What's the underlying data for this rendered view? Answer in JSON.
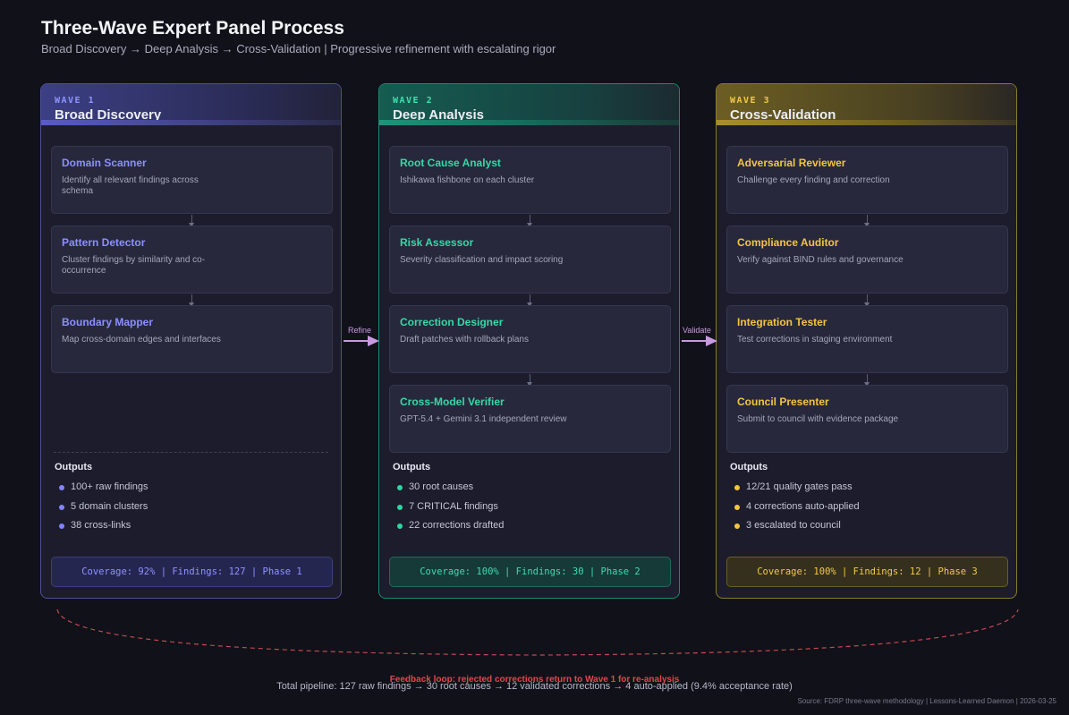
{
  "header": {
    "title": "Three-Wave Expert Panel Process",
    "subtitle": "Broad Discovery → Deep Analysis → Cross-Validation | Progressive refinement with escalating rigor"
  },
  "colors": {
    "wave1_accent": "#8b90ff",
    "wave2_accent": "#33d9a6",
    "wave3_accent": "#f4c53e",
    "feedback_loop": "#e0484c",
    "background": "#11111a"
  },
  "waves": [
    {
      "label": "WAVE 1",
      "name": "Broad Discovery",
      "experts": [
        {
          "title": "Domain Scanner",
          "desc": "Identify all relevant findings across schema"
        },
        {
          "title": "Pattern Detector",
          "desc": "Cluster findings by similarity and co-occurrence"
        },
        {
          "title": "Boundary Mapper",
          "desc": "Map cross-domain edges and interfaces"
        }
      ],
      "outputs_title": "Outputs",
      "outputs": [
        "100+ raw findings",
        "5 domain clusters",
        "38 cross-links"
      ],
      "coverage": "Coverage: 92% | Findings: 127 | Phase 1"
    },
    {
      "label": "WAVE 2",
      "name": "Deep Analysis",
      "experts": [
        {
          "title": "Root Cause Analyst",
          "desc": "Ishikawa fishbone on each cluster"
        },
        {
          "title": "Risk Assessor",
          "desc": "Severity classification and impact scoring"
        },
        {
          "title": "Correction Designer",
          "desc": "Draft patches with rollback plans"
        },
        {
          "title": "Cross-Model Verifier",
          "desc": "GPT-5.4 + Gemini 3.1 independent review"
        }
      ],
      "outputs_title": "Outputs",
      "outputs": [
        "30 root causes",
        "7 CRITICAL findings",
        "22 corrections drafted"
      ],
      "coverage": "Coverage: 100% | Findings: 30 | Phase 2"
    },
    {
      "label": "WAVE 3",
      "name": "Cross-Validation",
      "experts": [
        {
          "title": "Adversarial Reviewer",
          "desc": "Challenge every finding and correction"
        },
        {
          "title": "Compliance Auditor",
          "desc": "Verify against BIND rules and governance"
        },
        {
          "title": "Integration Tester",
          "desc": "Test corrections in staging environment"
        },
        {
          "title": "Council Presenter",
          "desc": "Submit to council with evidence package"
        }
      ],
      "outputs_title": "Outputs",
      "outputs": [
        "12/21 quality gates pass",
        "4 corrections auto-applied",
        "3 escalated to council"
      ],
      "coverage": "Coverage: 100% | Findings: 12 | Phase 3"
    }
  ],
  "transitions": [
    {
      "label": "Refine",
      "icon": "arrow-right-icon"
    },
    {
      "label": "Validate",
      "icon": "arrow-right-icon"
    }
  ],
  "feedback": {
    "label": "Feedback loop: rejected corrections return to Wave 1 for re-analysis"
  },
  "footer": {
    "total": "Total pipeline: 127 raw findings → 30 root causes → 12 validated corrections → 4 auto-applied (9.4% acceptance rate)",
    "source": "Source: FDRP three-wave methodology | Lessons-Learned Daemon | 2026-03-25"
  }
}
